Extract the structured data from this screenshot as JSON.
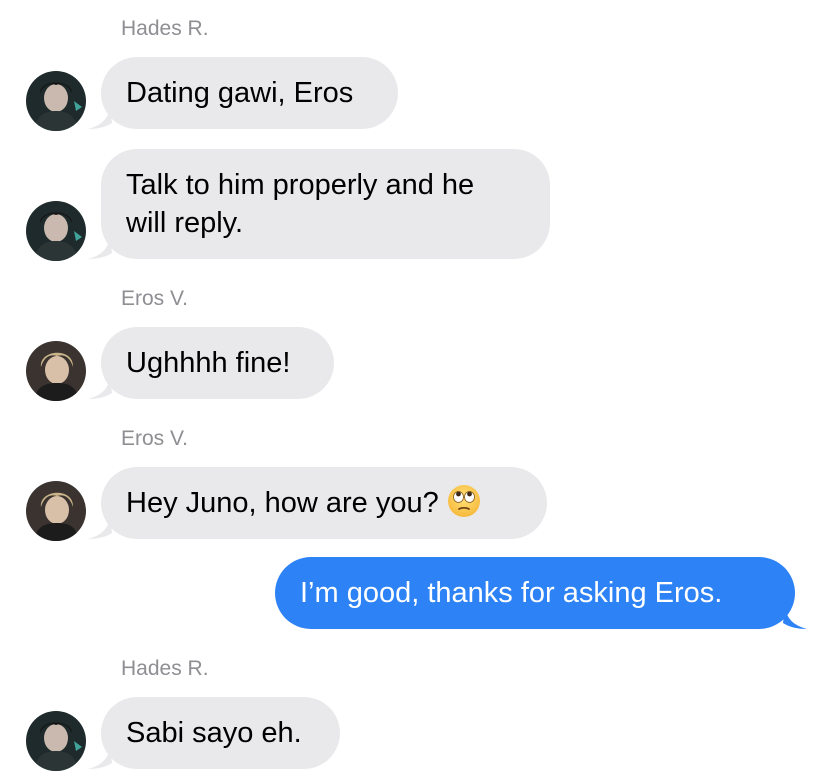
{
  "conversation": {
    "messages": [
      {
        "sender": "Hades R.",
        "text": "Dating gawi, Eros",
        "direction": "incoming"
      },
      {
        "sender": "Hades R.",
        "text_line1": "Talk to him properly and he",
        "text_line2": "will reply.",
        "direction": "incoming"
      },
      {
        "sender": "Eros V.",
        "text": "Ughhhh fine!",
        "direction": "incoming"
      },
      {
        "sender": "Eros V.",
        "text": "Hey Juno, how are you?",
        "emoji": "face-with-rolling-eyes",
        "direction": "incoming"
      },
      {
        "sender": "me",
        "text": "I’m good, thanks for asking Eros.",
        "direction": "outgoing"
      },
      {
        "sender": "Hades R.",
        "text": "Sabi sayo eh.",
        "direction": "incoming"
      }
    ],
    "sender_labels": {
      "first": "Hades R.",
      "second": "Eros V.",
      "third": "Eros V.",
      "fourth": "Hades R."
    }
  },
  "colors": {
    "incoming_bubble": "#e9e9eb",
    "outgoing_bubble": "#2d82f6",
    "sender_label": "#8e8e93"
  }
}
